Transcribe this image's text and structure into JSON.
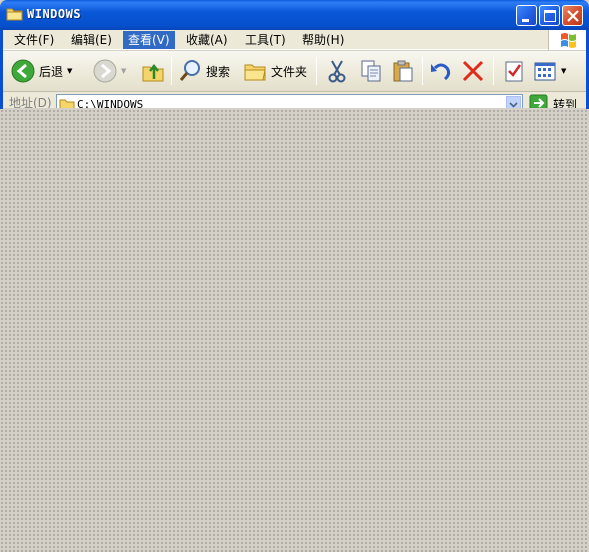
{
  "window": {
    "title": "WINDOWS",
    "colors": {
      "title_blue": "#0a58d8",
      "menu_bg": "#ece9d8",
      "highlight": "#316ac5",
      "close_red": "#d6502e"
    }
  },
  "menubar": {
    "items": [
      {
        "label": "文件(F)"
      },
      {
        "label": "编辑(E)"
      },
      {
        "label": "查看(V)",
        "active": true
      },
      {
        "label": "收藏(A)"
      },
      {
        "label": "工具(T)"
      },
      {
        "label": "帮助(H)"
      }
    ]
  },
  "toolbar": {
    "back_label": "后退",
    "search_label": "搜索",
    "folders_label": "文件夹",
    "icons": [
      "back-arrow",
      "forward-arrow",
      "up-folder",
      "search",
      "folders",
      "cut",
      "copy",
      "paste",
      "undo",
      "delete",
      "properties",
      "views"
    ]
  },
  "addressbar": {
    "label": "地址(D)",
    "value": "C:\\WINDOWS",
    "go_label": "转到"
  }
}
